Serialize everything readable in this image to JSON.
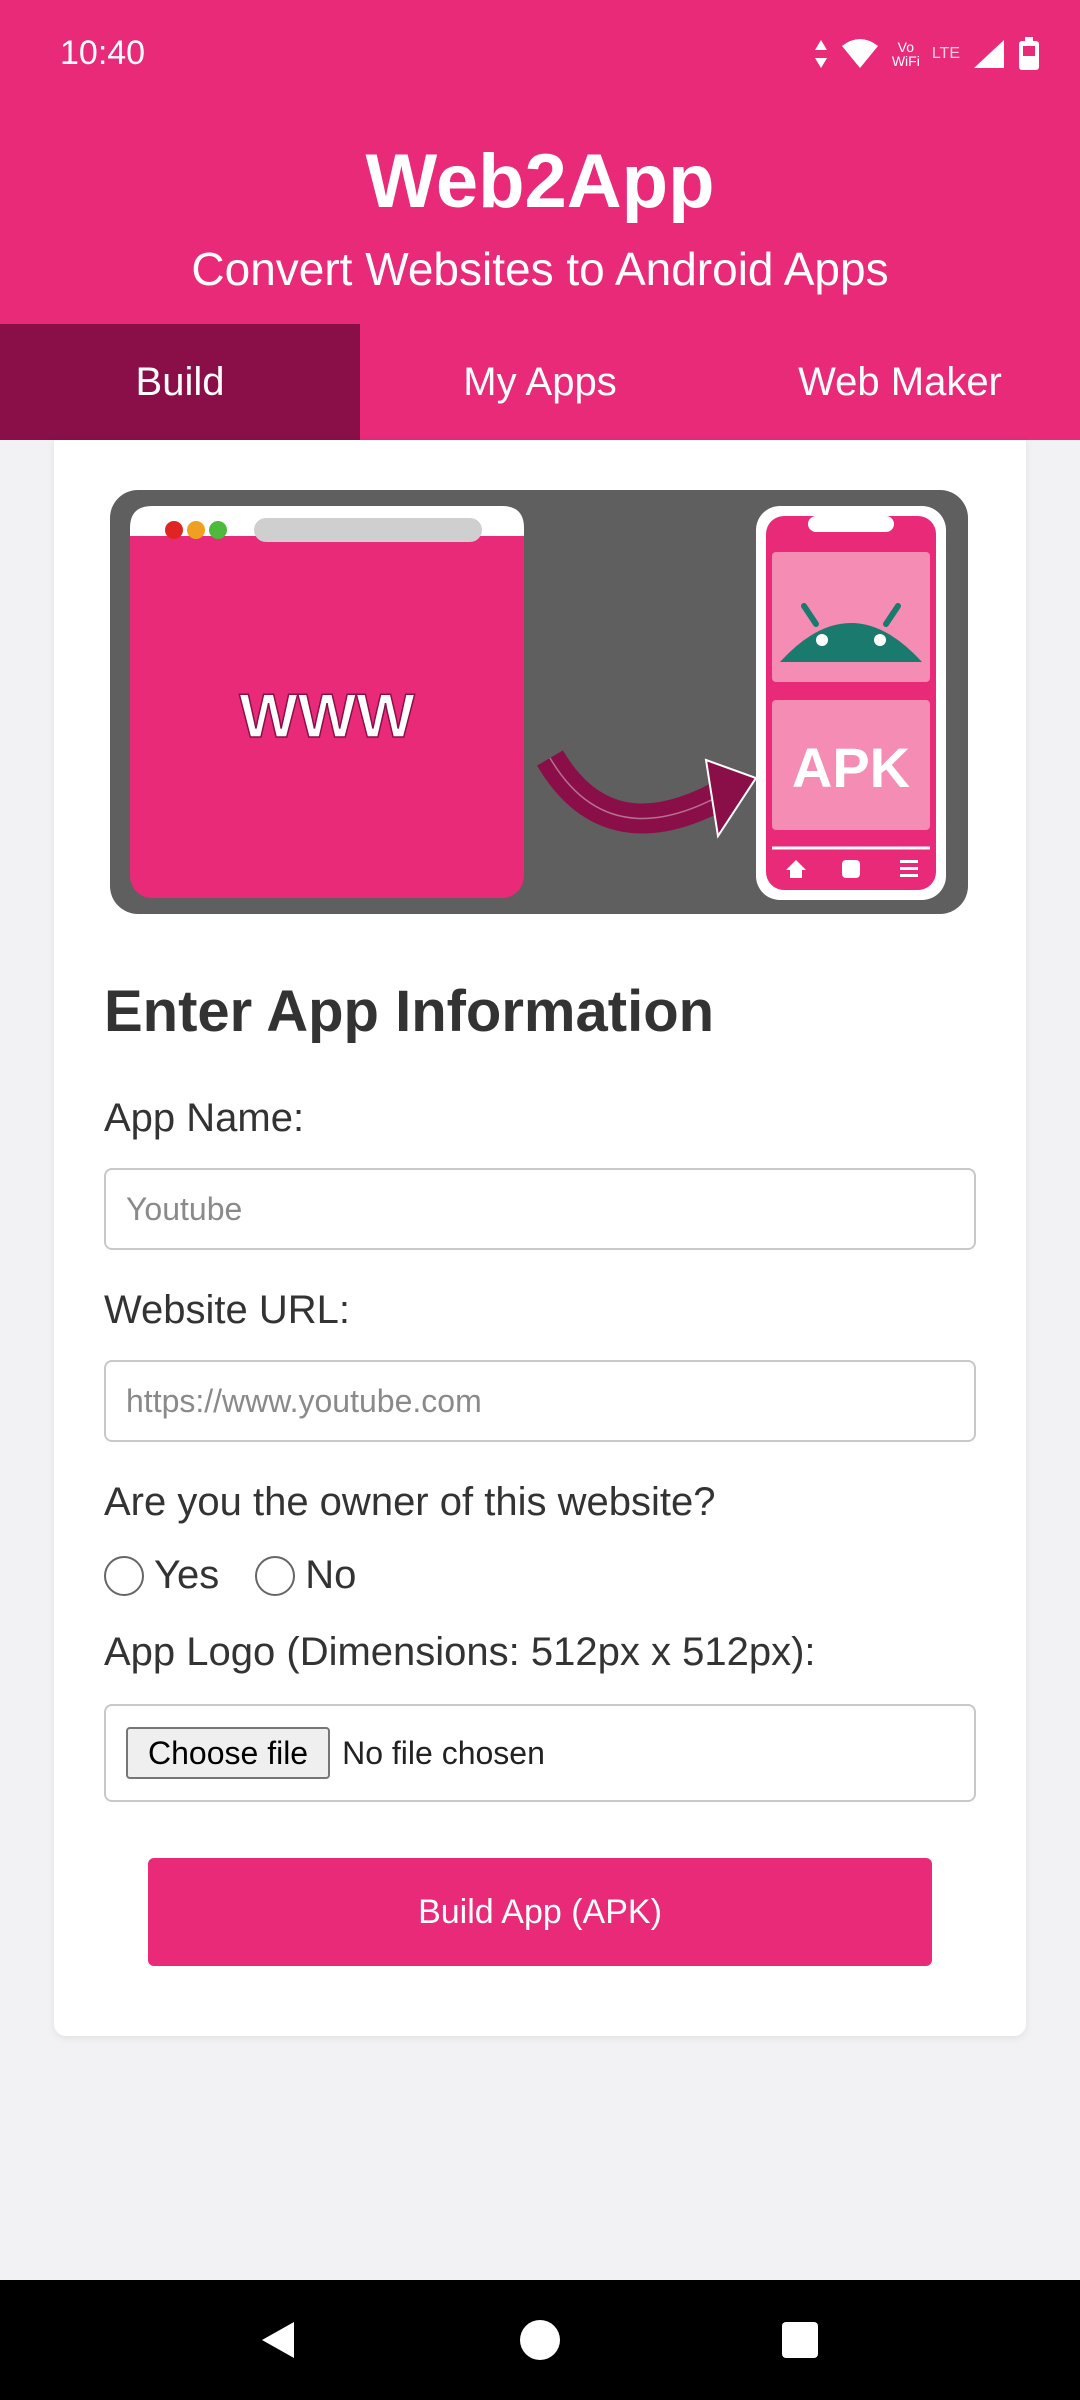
{
  "status_bar": {
    "time": "10:40",
    "vowifi": [
      "Vo",
      "WiFi"
    ],
    "lte": "LTE",
    "icons": [
      "data-arrows-icon",
      "wifi-icon",
      "cell-signal-icon",
      "battery-icon"
    ]
  },
  "header": {
    "title": "Web2App",
    "subtitle": "Convert Websites to Android Apps"
  },
  "tabs": [
    {
      "label": "Build",
      "active": true
    },
    {
      "label": "My Apps",
      "active": false
    },
    {
      "label": "Web Maker",
      "active": false
    }
  ],
  "illustration": {
    "browser_text": "WWW",
    "phone_text": "APK",
    "icons": [
      "browser-window",
      "curved-arrow-icon",
      "phone",
      "android-icon",
      "home-icon"
    ]
  },
  "form": {
    "heading": "Enter App Information",
    "app_name_label": "App Name:",
    "app_name_placeholder": "Youtube",
    "url_label": "Website URL:",
    "url_placeholder": "https://www.youtube.com",
    "owner_question": "Are you the owner of this website?",
    "owner_yes": "Yes",
    "owner_no": "No",
    "logo_label": "App Logo (Dimensions: 512px x 512px):",
    "file_button": "Choose file",
    "file_status": "No file chosen",
    "submit_label": "Build App (APK)"
  },
  "nav_bar": {
    "icons": [
      "back-icon",
      "home-icon",
      "recents-icon"
    ]
  },
  "colors": {
    "brand": "#e82a78",
    "tab_active": "#8a0f49",
    "illustration_bg": "#5f5f5f",
    "android_green": "#1a7a6e"
  }
}
